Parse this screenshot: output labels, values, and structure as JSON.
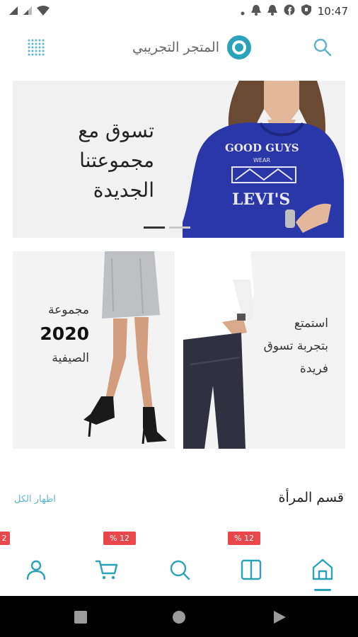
{
  "status_bar": {
    "time": "10:47",
    "left_icons": [
      "signal-icon",
      "signal-alt-icon",
      "wifi-icon"
    ],
    "right_icons": [
      "dot-icon",
      "bell-icon",
      "bell-icon",
      "facebook-icon",
      "shield-icon"
    ]
  },
  "app_bar": {
    "store_name": "المتجر التجريبي",
    "menu_icon": "grid-dots-icon",
    "logo_icon": "ring-logo-icon",
    "search_icon": "search-icon"
  },
  "hero": {
    "text": "تسوق مع مجموعتنا الجديدة",
    "slides": 2,
    "active_slide": 1
  },
  "promo_left": {
    "line1": "مجموعة",
    "year": "2020",
    "line3": "الصيفية"
  },
  "promo_right": {
    "line1": "استمتع",
    "line2": "بتجربة تسوق",
    "line3": "فريدة"
  },
  "section": {
    "title": "قسم المرأة",
    "show_all": "اظهار الكل"
  },
  "badges": [
    "% 12",
    "% 12",
    "2"
  ],
  "bottom_nav": {
    "items": [
      "home-icon",
      "columns-icon",
      "search-icon",
      "cart-icon",
      "user-icon"
    ],
    "active": "home-icon"
  },
  "colors": {
    "accent": "#2aa3b8",
    "badge": "#e8474b",
    "show_all": "#5fb4c5"
  }
}
